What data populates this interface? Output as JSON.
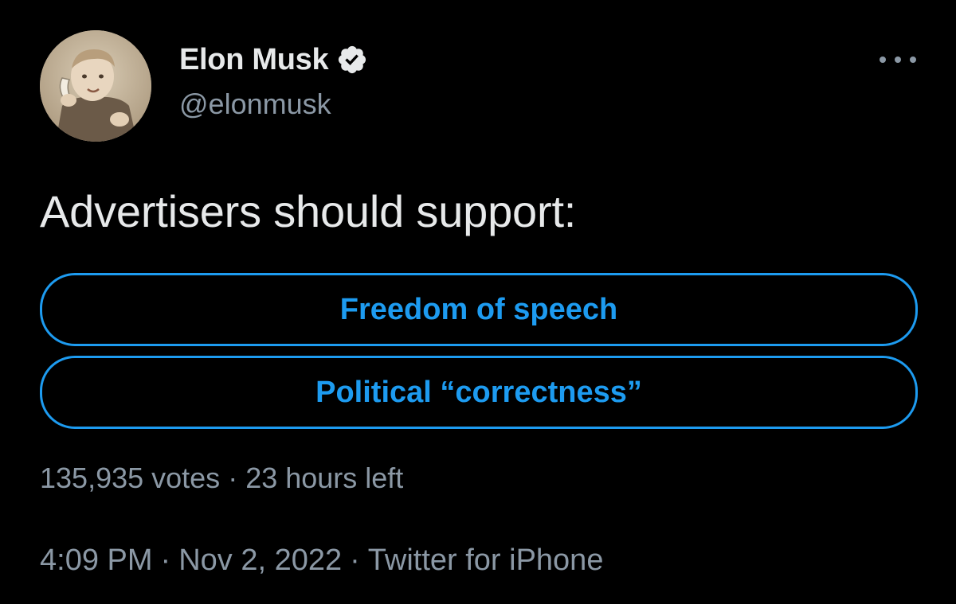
{
  "author": {
    "display_name": "Elon Musk",
    "handle": "@elonmusk",
    "verified_icon": "verified-badge-icon",
    "avatar_icon": "profile-photo"
  },
  "tweet": {
    "text": "Advertisers should support:"
  },
  "poll": {
    "options": [
      {
        "label": "Freedom of speech"
      },
      {
        "label": "Political “correctness”"
      }
    ],
    "votes": "135,935 votes",
    "separator": "·",
    "time_left": "23 hours left"
  },
  "meta": {
    "time": "4:09 PM",
    "separator": "·",
    "date": "Nov 2, 2022",
    "source": "Twitter for iPhone"
  },
  "colors": {
    "background": "#000000",
    "primary_text": "#e7e9ea",
    "secondary_text": "#8b98a5",
    "accent": "#1d9bf0"
  },
  "more_icon": "more-options-icon"
}
